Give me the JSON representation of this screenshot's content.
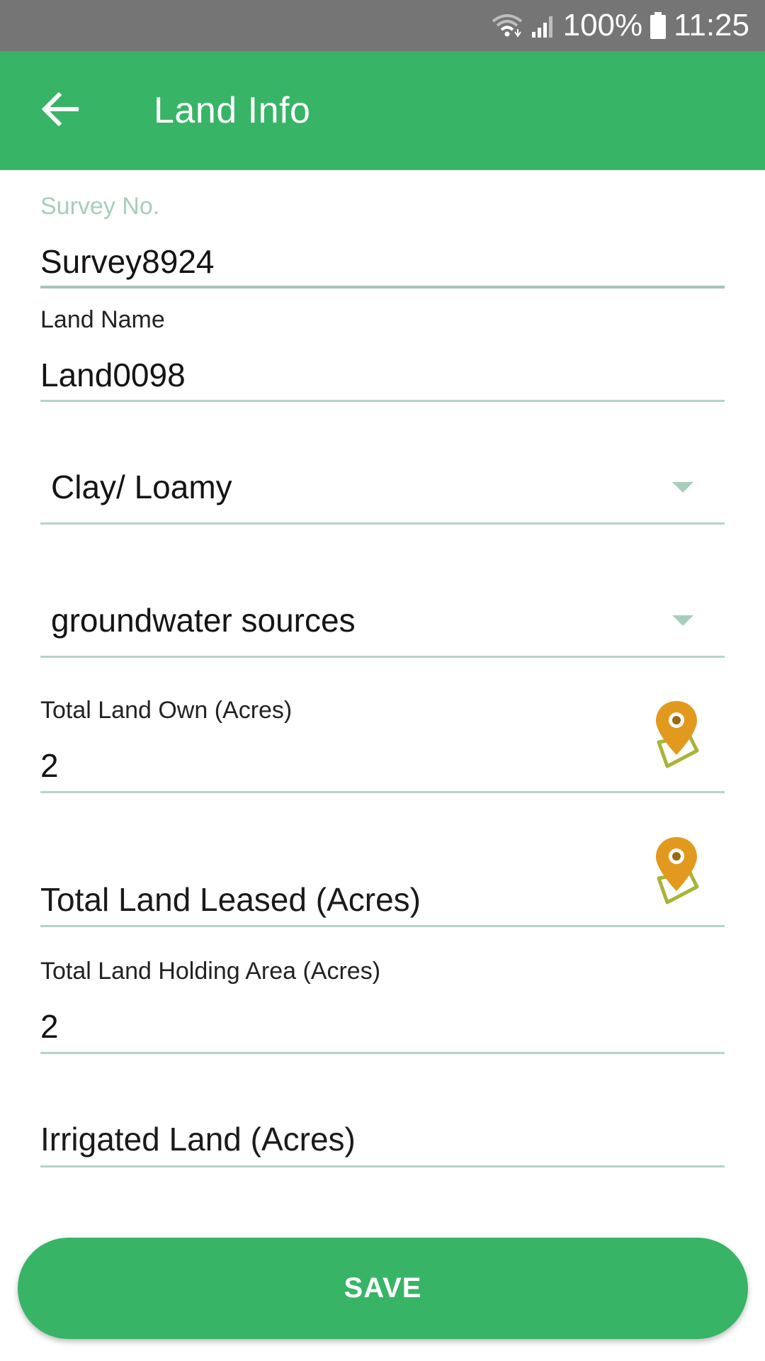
{
  "status_bar": {
    "battery": "100%",
    "time": "11:25",
    "icons": [
      "wifi-icon",
      "signal-icon",
      "battery-icon"
    ]
  },
  "app_bar": {
    "title": "Land Info",
    "back_icon": "arrow-left-icon",
    "color": "#38b467"
  },
  "form": {
    "survey_no": {
      "label": "Survey No.",
      "value": "Survey8924"
    },
    "land_name": {
      "label": "Land Name",
      "value": "Land0098"
    },
    "soil_type": {
      "selected": "Clay/ Loamy"
    },
    "water_source": {
      "selected": "groundwater sources"
    },
    "total_land_own": {
      "label": "Total Land Own (Acres)",
      "value": "2",
      "icon": "map-pin-icon"
    },
    "total_land_leased": {
      "placeholder": "Total Land Leased (Acres)",
      "icon": "map-pin-icon"
    },
    "total_land_holding": {
      "label": "Total Land Holding Area (Acres)",
      "value": "2"
    },
    "irrigated_land": {
      "placeholder": "Irrigated Land (Acres)"
    }
  },
  "save_button": {
    "label": "SAVE"
  },
  "colors": {
    "accent": "#38b467",
    "pin": "#e29a1e",
    "pin_outline": "#a8b437"
  }
}
